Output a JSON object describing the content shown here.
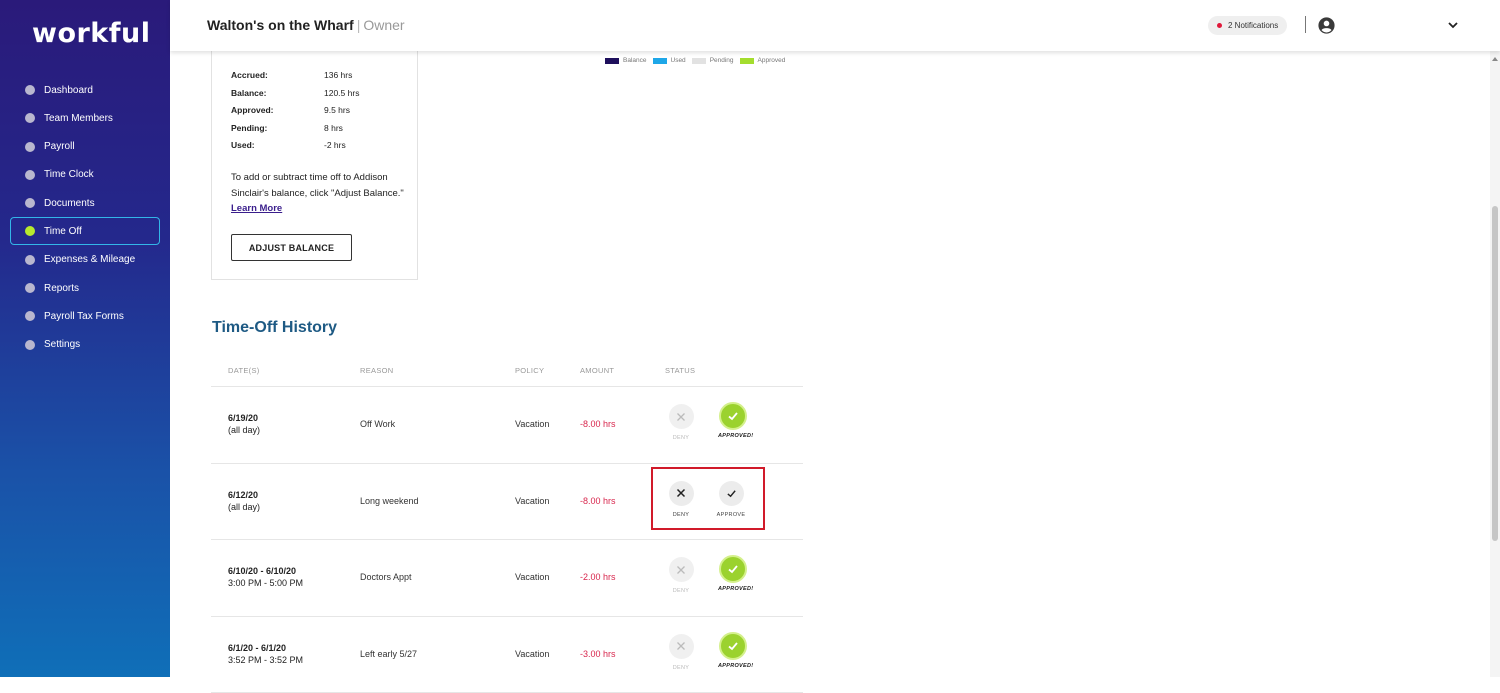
{
  "app": {
    "logo": "workful"
  },
  "sidebar": {
    "items": [
      {
        "label": "Dashboard"
      },
      {
        "label": "Team Members"
      },
      {
        "label": "Payroll"
      },
      {
        "label": "Time Clock"
      },
      {
        "label": "Documents"
      },
      {
        "label": "Time Off",
        "active": true
      },
      {
        "label": "Expenses & Mileage"
      },
      {
        "label": "Reports"
      },
      {
        "label": "Payroll Tax Forms"
      },
      {
        "label": "Settings"
      }
    ]
  },
  "header": {
    "business_name": "Walton's on the Wharf",
    "separator": "|",
    "role": "Owner",
    "notifications": "2 Notifications",
    "user_icon": "user-circle-icon",
    "dropdown_icon": "chevron-down-icon"
  },
  "balance": {
    "rows": [
      {
        "label": "Accrued:",
        "value": "136 hrs"
      },
      {
        "label": "Balance:",
        "value": "120.5 hrs"
      },
      {
        "label": "Approved:",
        "value": "9.5 hrs"
      },
      {
        "label": "Pending:",
        "value": "8 hrs"
      },
      {
        "label": "Used:",
        "value": "-2 hrs"
      }
    ],
    "note": "To add or subtract time off to Addison Sinclair's balance, click \"Adjust Balance.\"",
    "learn_more": "Learn More",
    "adjust_button": "ADJUST BALANCE"
  },
  "legend": {
    "items": [
      {
        "label": "Balance",
        "color": "#1e0f5c"
      },
      {
        "label": "Used",
        "color": "#1ea7e8"
      },
      {
        "label": "Pending",
        "color": "#e2e2e2"
      },
      {
        "label": "Approved",
        "color": "#a4dd2e"
      }
    ]
  },
  "history": {
    "title": "Time-Off History",
    "columns": {
      "dates": "DATE(S)",
      "reason": "REASON",
      "policy": "POLICY",
      "amount": "AMOUNT",
      "status": "STATUS"
    },
    "rows": [
      {
        "date": "6/19/20",
        "time": "(all day)",
        "reason": "Off Work",
        "policy": "Vacation",
        "amount": "-8.00 hrs",
        "deny_label": "DENY",
        "status_label": "APPROVED!",
        "status": "approved"
      },
      {
        "date": "6/12/20",
        "time": "(all day)",
        "reason": "Long weekend",
        "policy": "Vacation",
        "amount": "-8.00 hrs",
        "deny_label": "DENY",
        "status_label": "APPROVE",
        "status": "pending"
      },
      {
        "date": "6/10/20 - 6/10/20",
        "time": "3:00 PM - 5:00 PM",
        "reason": "Doctors Appt",
        "policy": "Vacation",
        "amount": "-2.00 hrs",
        "deny_label": "DENY",
        "status_label": "APPROVED!",
        "status": "approved"
      },
      {
        "date": "6/1/20 - 6/1/20",
        "time": "3:52 PM - 3:52 PM",
        "reason": "Left early 5/27",
        "policy": "Vacation",
        "amount": "-3.00 hrs",
        "deny_label": "DENY",
        "status_label": "APPROVED!",
        "status": "approved"
      }
    ]
  }
}
